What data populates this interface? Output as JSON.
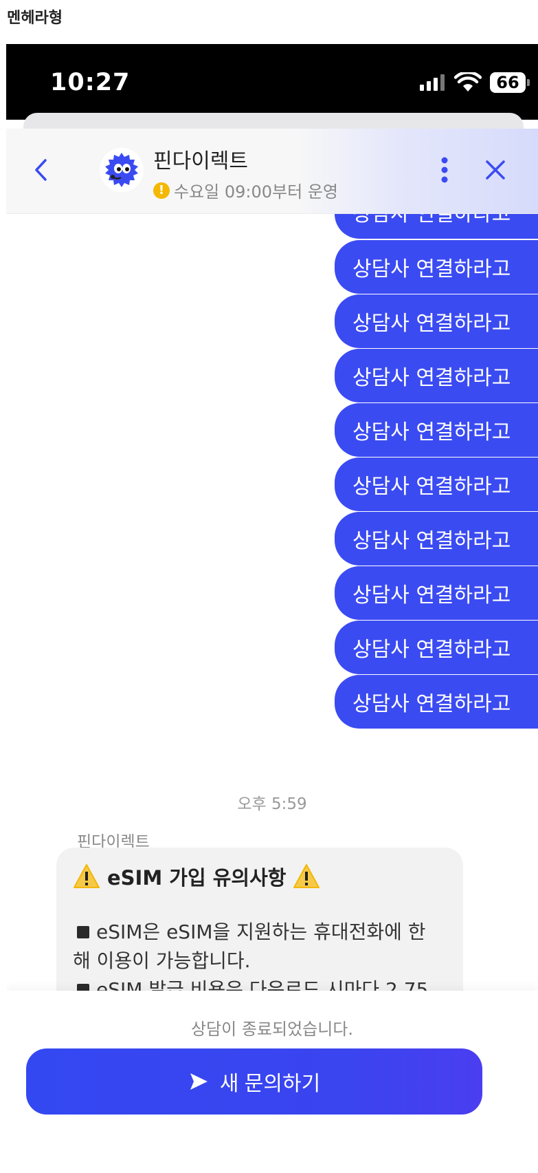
{
  "page_caption": "멘헤라형",
  "status_bar": {
    "time": "10:27",
    "battery": "66"
  },
  "header": {
    "title": "핀다이렉트",
    "subtitle": "수요일 09:00부터 운영",
    "warning_mark": "!"
  },
  "messages": {
    "user_messages": [
      "상담사 연결하라고",
      "상담사 연결하라고",
      "상담사 연결하라고",
      "상담사 연결하라고",
      "상담사 연결하라고",
      "상담사 연결하라고",
      "상담사 연결하라고",
      "상담사 연결하라고",
      "상담사 연결하라고",
      "상담사 연결하라고"
    ],
    "timestamp": "오후 5:59",
    "bot_sender": "핀다이렉트",
    "bot_title": "eSIM 가입 유의사항",
    "bot_lines": [
      "eSIM은 eSIM을 지원하는 휴대전화에 한",
      "해 이용이 가능합니다.",
      "eSIM 발급 비용은 다운로드 시마다 2,75"
    ]
  },
  "footer": {
    "ended_text": "상담이 종료되었습니다.",
    "new_inquiry_label": "새 문의하기"
  },
  "colors": {
    "accent": "#3b4bf2",
    "warning": "#f5b800"
  }
}
